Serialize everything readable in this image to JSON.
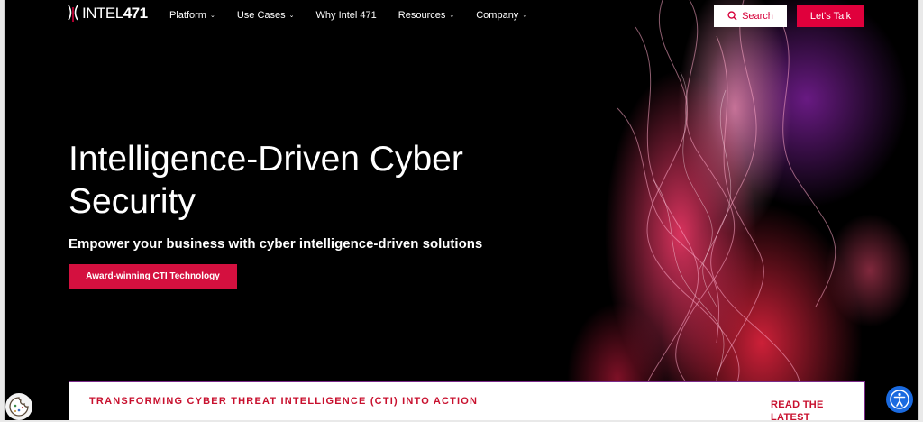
{
  "logo": {
    "text_main": "INTEL",
    "text_num": "471"
  },
  "nav": {
    "items": [
      {
        "label": "Platform",
        "has_dropdown": true
      },
      {
        "label": "Use Cases",
        "has_dropdown": true
      },
      {
        "label": "Why Intel 471",
        "has_dropdown": false
      },
      {
        "label": "Resources",
        "has_dropdown": true
      },
      {
        "label": "Company",
        "has_dropdown": true
      }
    ],
    "chevron": "⌄"
  },
  "header": {
    "search_label": "Search",
    "talk_label": "Let's Talk"
  },
  "hero": {
    "title": "Intelligence-Driven Cyber Security",
    "subtitle": "Empower your business with cyber intelligence-driven solutions",
    "cta_label": "Award-winning CTI Technology"
  },
  "panel": {
    "title": "TRANSFORMING CYBER THREAT INTELLIGENCE (CTI) INTO ACTION",
    "link": "READ THE LATEST"
  },
  "colors": {
    "accent": "#e0003c",
    "panel_border": "#7a2a8a",
    "a11y": "#1a6ae0"
  },
  "icons": {
    "search": "search-icon",
    "cookie": "cookie-icon",
    "accessibility": "accessibility-icon"
  }
}
